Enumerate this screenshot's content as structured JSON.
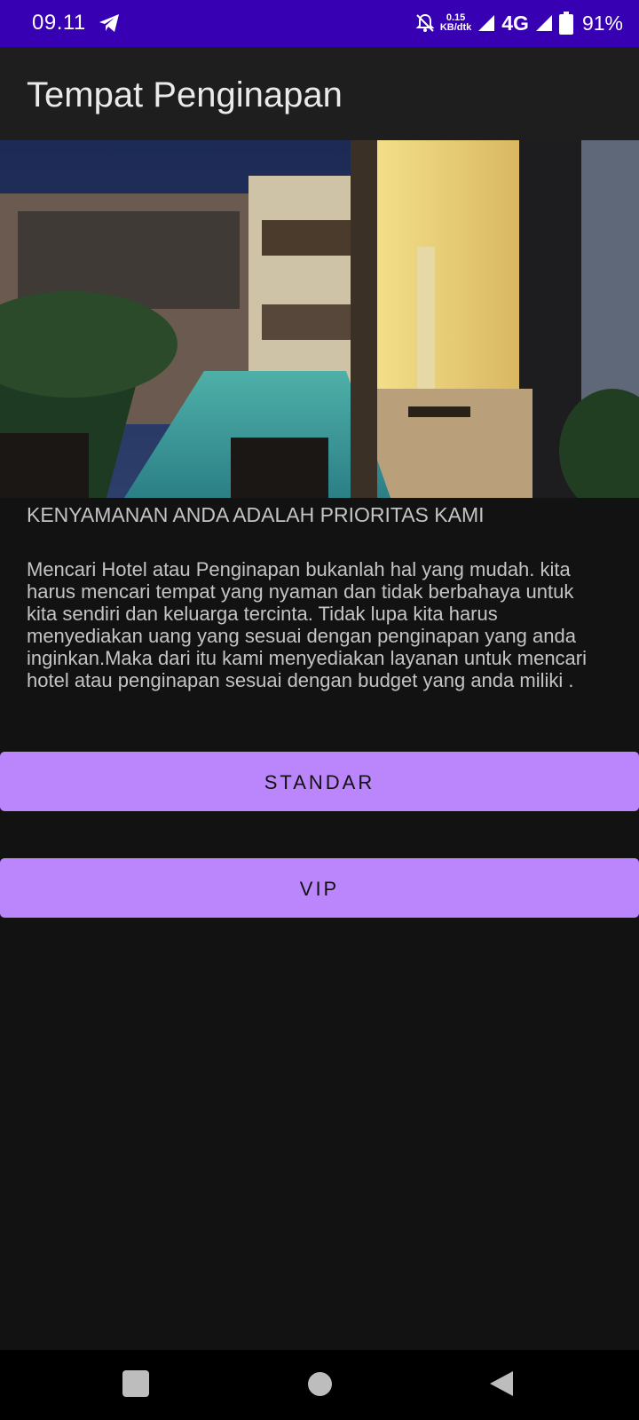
{
  "status_bar": {
    "time": "09.11",
    "net_speed_value": "0.15",
    "net_speed_unit": "KB/dtk",
    "network_type": "4G",
    "battery": "91%",
    "icons": [
      "telegram-icon",
      "bell-off-icon",
      "signal-icon",
      "battery-icon"
    ]
  },
  "app_bar": {
    "title": "Tempat Penginapan"
  },
  "content": {
    "tagline": "KENYAMANAN ANDA ADALAH PRIORITAS KAMI",
    "description": "Mencari Hotel atau Penginapan bukanlah hal yang mudah. kita harus mencari tempat yang nyaman dan tidak berbahaya untuk kita sendiri dan keluarga tercinta. Tidak lupa kita harus menyediakan uang yang sesuai dengan penginapan yang anda inginkan.Maka dari itu kami menyediakan layanan untuk mencari hotel atau penginapan sesuai dengan budget yang anda miliki ."
  },
  "buttons": {
    "standar": "STANDAR",
    "vip": "VIP"
  },
  "colors": {
    "status_bar": "#3700B3",
    "accent": "#BB86FC",
    "background": "#121212"
  },
  "nav": {
    "icons": [
      "recents-square-icon",
      "home-circle-icon",
      "back-triangle-icon"
    ]
  }
}
